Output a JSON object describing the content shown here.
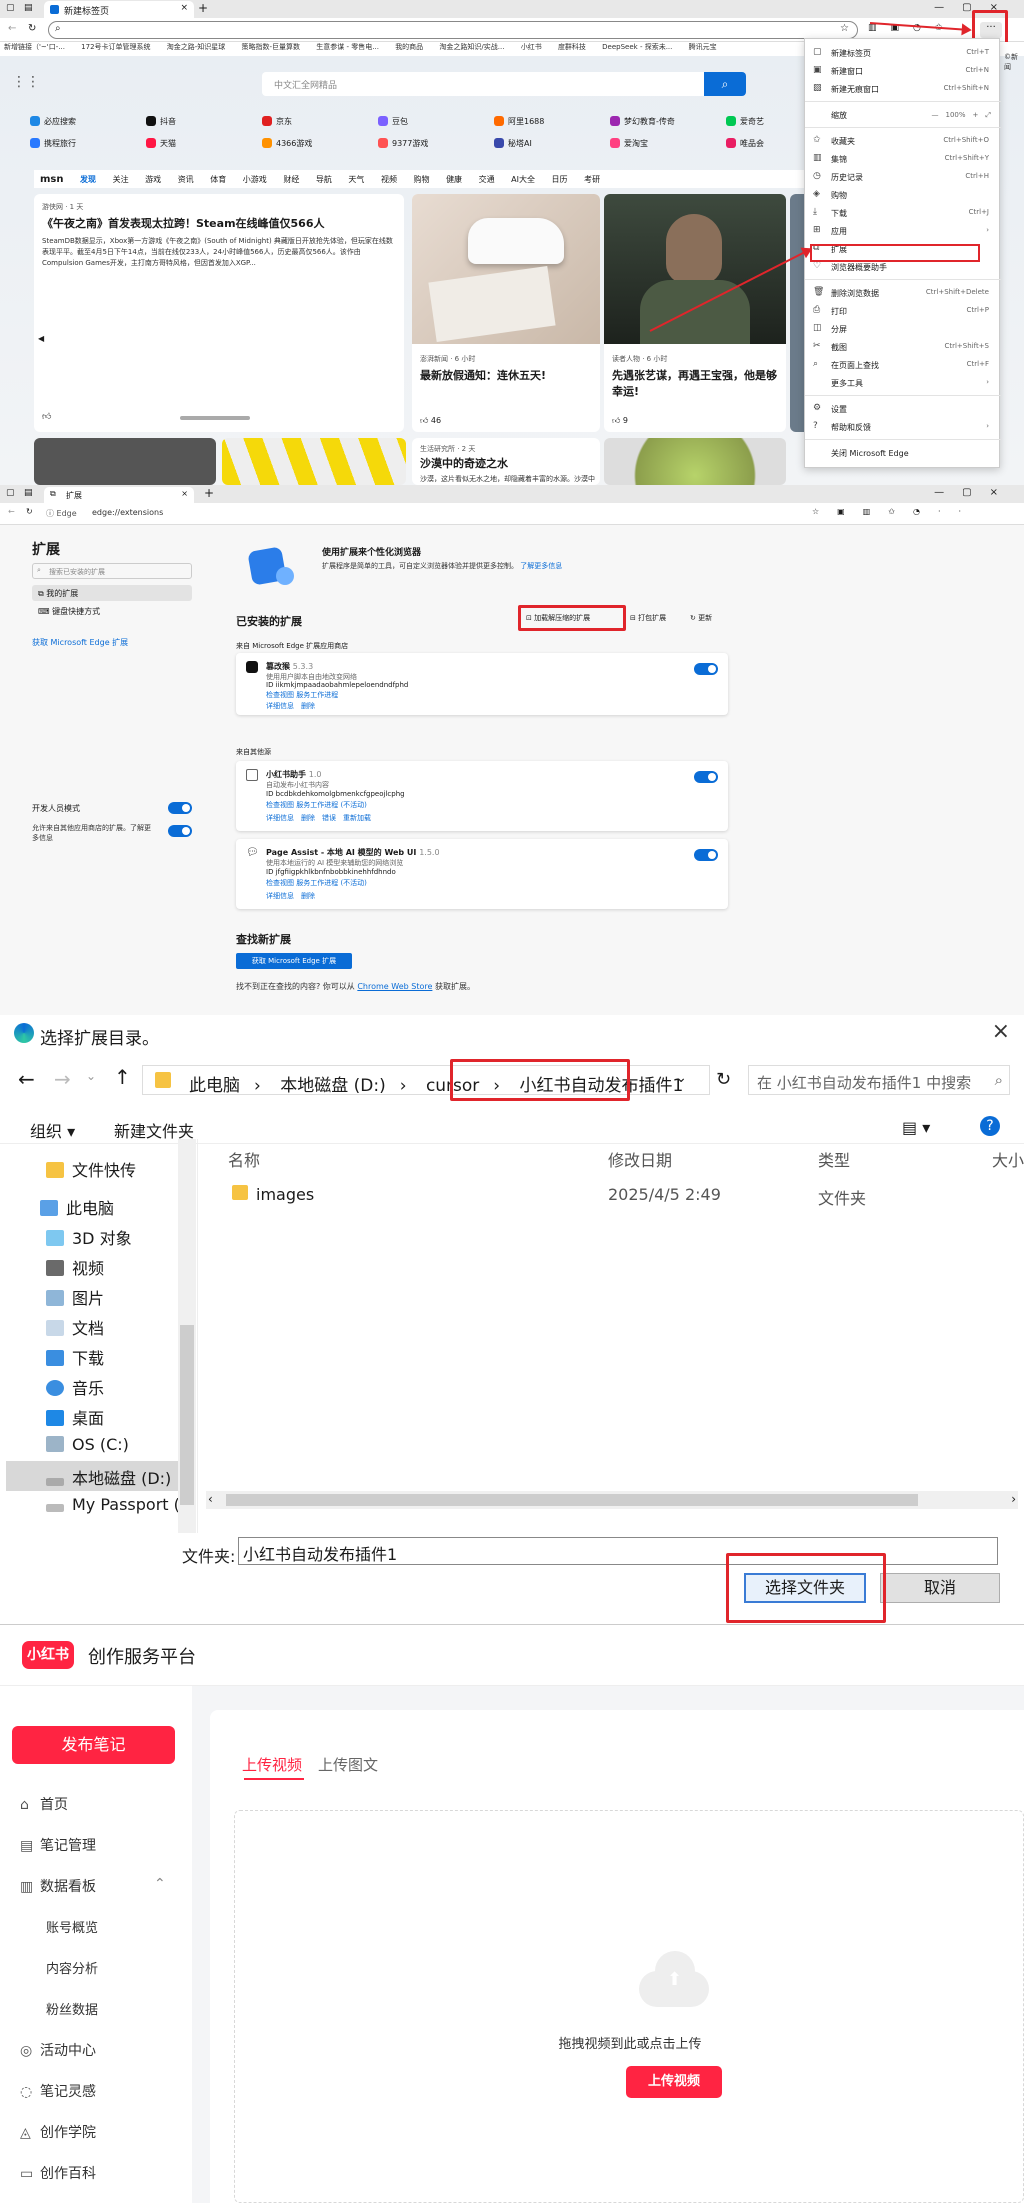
{
  "p1": {
    "tab_title": "新建标签页",
    "favorites": [
      "新增链接（'~'口-...",
      "172号卡订单管理系统",
      "淘金之路-知识星球",
      "策略指数-巨量算数",
      "生意参谋 - 零售电...",
      "我的商品",
      "淘金之路知识/实战...",
      "小红书",
      "度群科技",
      "DeepSeek - 探索未...",
      "腾讯元宝"
    ],
    "search_placeholder": "中文汇全网精品",
    "sites_row1": [
      "必应搜索",
      "抖音",
      "京东",
      "豆包",
      "阿里1688",
      "梦幻教育-传奇",
      "爱奇艺"
    ],
    "sites_row2": [
      "携程旅行",
      "天猫",
      "4366游戏",
      "9377游戏",
      "秘塔AI",
      "爱淘宝",
      "唯品会"
    ],
    "msn_tabs": [
      "msn",
      "发现",
      "关注",
      "游戏",
      "资讯",
      "体育",
      "小游戏",
      "财经",
      "导航",
      "天气",
      "视频",
      "购物",
      "健康",
      "交通",
      "AI大全",
      "日历",
      "考研"
    ],
    "card1": {
      "source": "游侠网 · 1 天",
      "title": "《午夜之南》首发表现太拉跨！Steam在线峰值仅566人",
      "body": "SteamDB数据显示，Xbox第一方游戏《午夜之南》(South of Midnight) 典藏版日开放抢先体验，但玩家在线数表现平平。截至4月5日下午14点，当前在线仅233人，24小时峰值566人，历史最高仅566人。该作由Compulsion Games开发，主打南方哥特风格，但因首发加入XGP...",
      "likes": ""
    },
    "card2": {
      "source": "澎湃新闻 · 6 小时",
      "title": "最新放假通知：连休五天!",
      "likes": "46"
    },
    "card3": {
      "source": "读者人物 · 6 小时",
      "title": "先遇张艺谋，再遇王宝强，他是够幸运!",
      "likes": "9"
    },
    "card4": {
      "source": "生活研究所 · 2 天",
      "title": "沙漠中的奇迹之水",
      "body": "沙漠，这片看似无水之地，却隐藏着丰富的水源。沙漠中的水源形成，是一个复杂而有趣的自然现象。首先，地下水是沙漠水源..."
    },
    "menu": [
      {
        "label": "新建标签页",
        "key": "Ctrl+T"
      },
      {
        "label": "新建窗口",
        "key": "Ctrl+N"
      },
      {
        "label": "新建无痕窗口",
        "key": "Ctrl+Shift+N"
      },
      {
        "label": "缩放",
        "key": "100%"
      },
      {
        "label": "收藏夹",
        "key": "Ctrl+Shift+O"
      },
      {
        "label": "集锦",
        "key": "Ctrl+Shift+Y"
      },
      {
        "label": "历史记录",
        "key": "Ctrl+H"
      },
      {
        "label": "购物",
        "key": ""
      },
      {
        "label": "下载",
        "key": "Ctrl+J"
      },
      {
        "label": "应用",
        "key": ""
      },
      {
        "label": "扩展",
        "key": ""
      },
      {
        "label": "浏览器概要助手",
        "key": ""
      },
      {
        "label": "删除浏览数据",
        "key": "Ctrl+Shift+Delete"
      },
      {
        "label": "打印",
        "key": "Ctrl+P"
      },
      {
        "label": "分屏",
        "key": ""
      },
      {
        "label": "截图",
        "key": "Ctrl+Shift+S"
      },
      {
        "label": "在页面上查找",
        "key": "Ctrl+F"
      },
      {
        "label": "更多工具",
        "key": ""
      },
      {
        "label": "设置",
        "key": ""
      },
      {
        "label": "帮助和反馈",
        "key": ""
      },
      {
        "label": "关闭 Microsoft Edge",
        "key": ""
      }
    ],
    "edge_label": "©新闻"
  },
  "p2": {
    "tab_title": "扩展",
    "url_prefix": "Edge",
    "url": "edge://extensions",
    "side_title": "扩展",
    "side_search": "搜索已安装的扩展",
    "side_items": [
      "我的扩展",
      "键盘快捷方式"
    ],
    "side_link": "获取 Microsoft Edge 扩展",
    "dev_mode": "开发人员模式",
    "allow_other": "允许来自其他应用商店的扩展。了解更多信息",
    "banner_title": "使用扩展来个性化浏览器",
    "banner_text": "扩展程序是简单的工具，可自定义浏览器体验并提供更多控制。",
    "banner_link": "了解更多信息",
    "installed_title": "已安装的扩展",
    "load_unpacked": "加载解压缩的扩展",
    "pack": "打包扩展",
    "update": "更新",
    "from_store": "来自 Microsoft Edge 扩展应用商店",
    "from_other": "来自其他源",
    "exts": [
      {
        "name": "篡改猴",
        "ver": "5.3.3",
        "desc": "使用用户脚本自由地改变网络",
        "id": "ID iikmkjmpaadaobahmlepeloendndfphd",
        "check": "检查视图 服务工作进程",
        "links": "详细信息　删除"
      },
      {
        "name": "小红书助手",
        "ver": "1.0",
        "desc": "自动发布小红书内容",
        "id": "ID bcdbkdehkomolgbmenkcfgpeojlcphg",
        "check": "检查视图 服务工作进程 (不活动)",
        "links": "详细信息　删除　错误　重新加载"
      },
      {
        "name": "Page Assist - 本地 AI 模型的 Web UI",
        "ver": "1.5.0",
        "desc": "使用本地运行的 AI 模型来辅助您的网络浏览",
        "id": "ID jfgfiigpkhlkbnfnbobbkinehhfdhndo",
        "check": "检查视图 服务工作进程 (不活动)",
        "links": "详细信息　删除"
      }
    ],
    "find_title": "查找新扩展",
    "get_btn": "获取 Microsoft Edge 扩展",
    "find_text": "找不到正在查找的内容? 你可以从",
    "chrome_store": "Chrome Web Store",
    "find_text_end": "获取扩展。"
  },
  "p3": {
    "title": "选择扩展目录。",
    "crumbs": [
      "此电脑",
      "本地磁盘 (D:)",
      "cursor",
      "小红书自动发布插件1"
    ],
    "search_placeholder": "在 小红书自动发布插件1 中搜索",
    "organize": "组织 ▾",
    "new_folder": "新建文件夹",
    "tree": [
      "文件快传",
      "此电脑",
      "3D 对象",
      "视频",
      "图片",
      "文档",
      "下载",
      "音乐",
      "桌面",
      "OS (C:)",
      "本地磁盘 (D:)",
      "My Passport (E"
    ],
    "cols": [
      "名称",
      "修改日期",
      "类型",
      "大小"
    ],
    "row": {
      "name": "images",
      "date": "2025/4/5 2:49",
      "type": "文件夹"
    },
    "folder_label": "文件夹:",
    "folder_value": "小红书自动发布插件1",
    "select_btn": "选择文件夹",
    "cancel_btn": "取消"
  },
  "p4": {
    "logo": "小红书",
    "platform": "创作服务平台",
    "publish": "发布笔记",
    "nav": [
      "首页",
      "笔记管理",
      "数据看板"
    ],
    "subnav": [
      "账号概览",
      "内容分析",
      "粉丝数据"
    ],
    "nav2": [
      "活动中心",
      "笔记灵感",
      "创作学院",
      "创作百科"
    ],
    "tab_video": "上传视频",
    "tab_image": "上传图文",
    "drop_text": "拖拽视频到此或点击上传",
    "upload_btn": "上传视频"
  }
}
